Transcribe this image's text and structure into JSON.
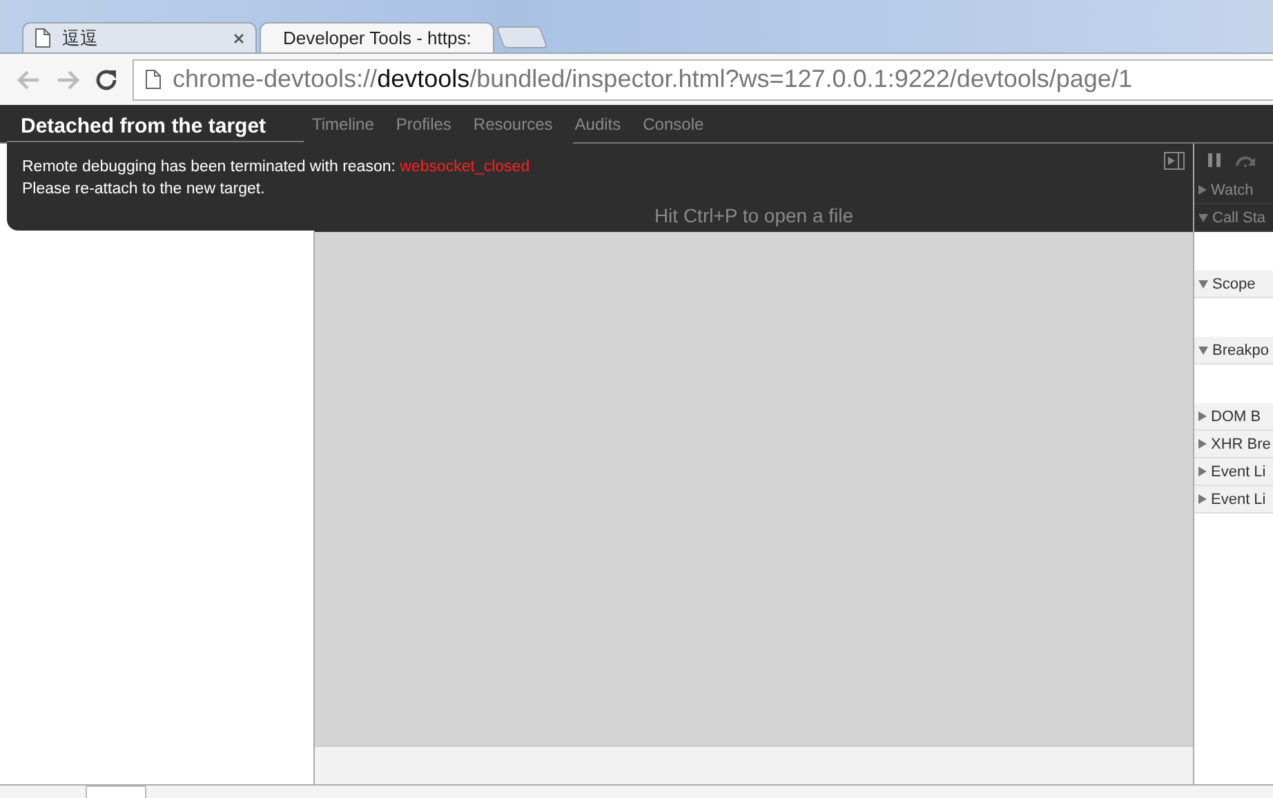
{
  "browser_tabs": [
    {
      "title": "逗逗",
      "selected": false
    },
    {
      "title": "Developer Tools - https:",
      "selected": true
    }
  ],
  "address_bar": {
    "scheme": "chrome-devtools://",
    "host": "devtools",
    "path": "/bundled/inspector.html?ws=127.0.0.1:9222/devtools/page/1"
  },
  "devtools_tabs": [
    "Timeline",
    "Profiles",
    "Resources",
    "Audits",
    "Console"
  ],
  "editor": {
    "hint": "Hit Ctrl+P to open a file"
  },
  "sidebar_sections": [
    {
      "label": "Watch",
      "expanded": false
    },
    {
      "label": "Call Sta",
      "expanded": true
    },
    {
      "label": "Scope",
      "expanded": true
    },
    {
      "label": "Breakpo",
      "expanded": true
    },
    {
      "label": "DOM B",
      "expanded": false
    },
    {
      "label": "XHR Bre",
      "expanded": false
    },
    {
      "label": "Event Li",
      "expanded": false
    },
    {
      "label": "Event Li",
      "expanded": false
    }
  ],
  "overlay": {
    "title": "Detached from the target",
    "message": "Remote debugging has been terminated with reason: ",
    "reason": "websocket_closed",
    "instruction": "Please re-attach to the new target."
  }
}
